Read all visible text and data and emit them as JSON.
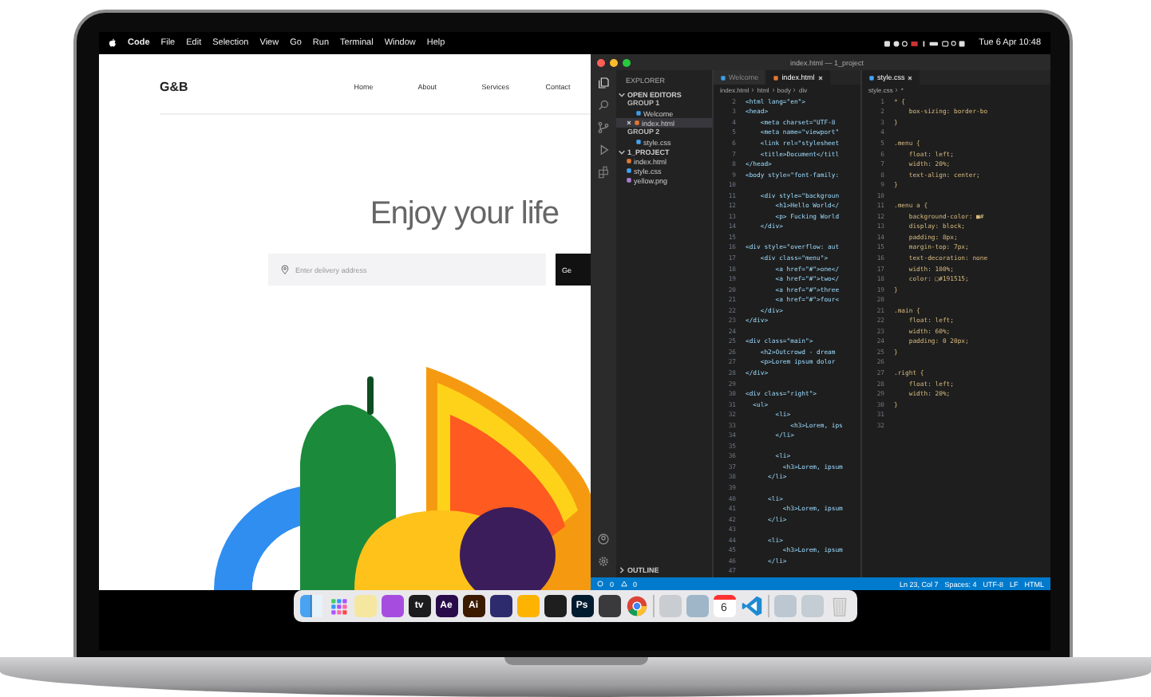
{
  "menubar": {
    "app": "Code",
    "items": [
      "File",
      "Edit",
      "Selection",
      "View",
      "Go",
      "Run",
      "Terminal",
      "Window",
      "Help"
    ],
    "clock": "Tue 6 Apr  10:48"
  },
  "website": {
    "logo": "G&B",
    "nav": [
      "Home",
      "About",
      "Services",
      "Contact"
    ],
    "headline": "Enjoy your life",
    "address_field": {
      "placeholder": "Enter delivery address"
    },
    "button": "Ge"
  },
  "editor": {
    "title": "index.html — 1_project",
    "explorer": {
      "title": "EXPLORER",
      "sections": [
        {
          "title": "OPEN EDITORS",
          "expanded": true,
          "children": [
            {
              "label": "GROUP 1",
              "children": [
                {
                  "label": "Welcome",
                  "kind": "vscode",
                  "selected": false
                },
                {
                  "label": "index.html",
                  "kind": "html",
                  "selected": true
                }
              ]
            },
            {
              "label": "GROUP 2",
              "children": [
                {
                  "label": "style.css",
                  "kind": "css",
                  "selected": false
                }
              ]
            }
          ]
        },
        {
          "title": "1_PROJECT",
          "expanded": true,
          "children": [
            {
              "label": "index.html",
              "kind": "html",
              "selected": false
            },
            {
              "label": "style.css",
              "kind": "css",
              "selected": false
            },
            {
              "label": "yellow.png",
              "kind": "image",
              "selected": false
            }
          ]
        },
        {
          "title": "OUTLINE",
          "expanded": false
        }
      ]
    },
    "groups": [
      {
        "tabs": [
          {
            "label": "Welcome",
            "kind": "vscode",
            "selected": false
          },
          {
            "label": "index.html",
            "kind": "html",
            "selected": true
          }
        ],
        "breadcrumb": [
          "index.html",
          "html",
          "body",
          "div"
        ],
        "lines": [
          {
            "n": "2",
            "code": "<html lang=\"en\">"
          },
          {
            "n": "3",
            "code": "<head>"
          },
          {
            "n": "4",
            "code": "    <meta charset=\"UTF-8"
          },
          {
            "n": "5",
            "code": "    <meta name=\"viewport\""
          },
          {
            "n": "6",
            "code": "    <link rel=\"stylesheet"
          },
          {
            "n": "7",
            "code": "    <title>Document</titl"
          },
          {
            "n": "8",
            "code": "</head>"
          },
          {
            "n": "9",
            "code": "<body style=\"font-family:"
          },
          {
            "n": "10"
          },
          {
            "n": "11",
            "code": "    <div style=\"backgroun"
          },
          {
            "n": "12",
            "code": "        <h1>Hello World</"
          },
          {
            "n": "13",
            "code": "        <p> Fucking World"
          },
          {
            "n": "14",
            "code": "    </div>"
          },
          {
            "n": "15"
          },
          {
            "n": "16",
            "code": "<div style=\"overflow: aut"
          },
          {
            "n": "17",
            "code": "    <div class=\"menu\">"
          },
          {
            "n": "18",
            "code": "        <a href=\"#\">one</"
          },
          {
            "n": "19",
            "code": "        <a href=\"#\">two</"
          },
          {
            "n": "20",
            "code": "        <a href=\"#\">three"
          },
          {
            "n": "21",
            "code": "        <a href=\"#\">four<"
          },
          {
            "n": "22",
            "code": "    </div>"
          },
          {
            "n": "23",
            "code": "</div>"
          },
          {
            "n": "24"
          },
          {
            "n": "25",
            "code": "<div class=\"main\">"
          },
          {
            "n": "26",
            "code": "    <h2>Outcrowd - dream"
          },
          {
            "n": "27",
            "code": "    <p>Lorem ipsum dolor"
          },
          {
            "n": "28",
            "code": "</div>"
          },
          {
            "n": "29"
          },
          {
            "n": "30",
            "code": "<div class=\"right\">"
          },
          {
            "n": "31",
            "code": "  <ul>"
          },
          {
            "n": "32",
            "code": "        <li>"
          },
          {
            "n": "33",
            "code": "            <h3>Lorem, ips"
          },
          {
            "n": "34",
            "code": "        </li>"
          },
          {
            "n": "35"
          },
          {
            "n": "36",
            "code": "        <li>"
          },
          {
            "n": "37",
            "code": "          <h3>Lorem, ipsum"
          },
          {
            "n": "38",
            "code": "      </li>"
          },
          {
            "n": "39"
          },
          {
            "n": "40",
            "code": "      <li>"
          },
          {
            "n": "41",
            "code": "          <h3>Lorem, ipsum"
          },
          {
            "n": "42",
            "code": "      </li>"
          },
          {
            "n": "43"
          },
          {
            "n": "44",
            "code": "      <li>"
          },
          {
            "n": "45",
            "code": "          <h3>Lorem, ipsum"
          },
          {
            "n": "46",
            "code": "      </li>"
          },
          {
            "n": "47"
          }
        ]
      },
      {
        "tabs": [
          {
            "label": "style.css",
            "kind": "css",
            "selected": true
          }
        ],
        "breadcrumb": [
          "style.css",
          "*"
        ],
        "lines": [
          {
            "n": "1",
            "code": "* {"
          },
          {
            "n": "2",
            "code": "    box-sizing: border-bo"
          },
          {
            "n": "3",
            "code": "}"
          },
          {
            "n": "4"
          },
          {
            "n": "5",
            "code": ".menu {"
          },
          {
            "n": "6",
            "code": "    float: left;"
          },
          {
            "n": "7",
            "code": "    width: 20%;"
          },
          {
            "n": "8",
            "code": "    text-align: center;"
          },
          {
            "n": "9",
            "code": "}"
          },
          {
            "n": "10"
          },
          {
            "n": "11",
            "code": ".menu a {"
          },
          {
            "n": "12",
            "code": "    background-color: ■#"
          },
          {
            "n": "13",
            "code": "    display: block;"
          },
          {
            "n": "14",
            "code": "    padding: 8px;"
          },
          {
            "n": "15",
            "code": "    margin-top: 7px;"
          },
          {
            "n": "16",
            "code": "    text-decoration: none"
          },
          {
            "n": "17",
            "code": "    width: 100%;"
          },
          {
            "n": "18",
            "code": "    color: □#191515;"
          },
          {
            "n": "19",
            "code": "}"
          },
          {
            "n": "20"
          },
          {
            "n": "21",
            "code": ".main {"
          },
          {
            "n": "22",
            "code": "    float: left;"
          },
          {
            "n": "23",
            "code": "    width: 60%;"
          },
          {
            "n": "24",
            "code": "    padding: 0 20px;"
          },
          {
            "n": "25",
            "code": "}"
          },
          {
            "n": "26"
          },
          {
            "n": "27",
            "code": ".right {"
          },
          {
            "n": "28",
            "code": "    float: left;"
          },
          {
            "n": "29",
            "code": "    width: 20%;"
          },
          {
            "n": "30",
            "code": "}"
          },
          {
            "n": "31"
          },
          {
            "n": "32"
          }
        ]
      }
    ],
    "status_bar": {
      "errors": "0",
      "warnings": "0",
      "position": "Ln 23, Col 7",
      "items": [
        "Spaces: 4",
        "UTF-8",
        "LF",
        "HTML"
      ]
    }
  },
  "dock": {
    "items": [
      {
        "kind": "finder"
      },
      {
        "kind": "launchpad"
      },
      {
        "kind": "tile",
        "color": "#f6e7a0"
      },
      {
        "kind": "tile",
        "color": "#a64de0"
      },
      {
        "kind": "tile",
        "color": "#1c1c1e",
        "label": "tv"
      },
      {
        "kind": "tile",
        "color": "#2a0b4a",
        "label": "Ae"
      },
      {
        "kind": "tile",
        "color": "#3b1a00",
        "label": "Ai"
      },
      {
        "kind": "tile",
        "color": "#2e2a6e"
      },
      {
        "kind": "tile",
        "color": "#fdb300"
      },
      {
        "kind": "tile",
        "color": "#1e1e1e"
      },
      {
        "kind": "tile",
        "color": "#031b2e",
        "label": "Ps"
      },
      {
        "kind": "tile",
        "color": "#3a3a3c"
      },
      {
        "kind": "chrome"
      },
      {
        "kind": "separator"
      },
      {
        "kind": "tile",
        "color": "#c9ccd1"
      },
      {
        "kind": "tile",
        "color": "#9fb6c9"
      },
      {
        "kind": "calendar",
        "label": "6"
      },
      {
        "kind": "vscode"
      },
      {
        "kind": "separator"
      },
      {
        "kind": "tile",
        "color": "#bcc7d2"
      },
      {
        "kind": "tile",
        "color": "#c4ccd4"
      },
      {
        "kind": "trash"
      }
    ]
  }
}
